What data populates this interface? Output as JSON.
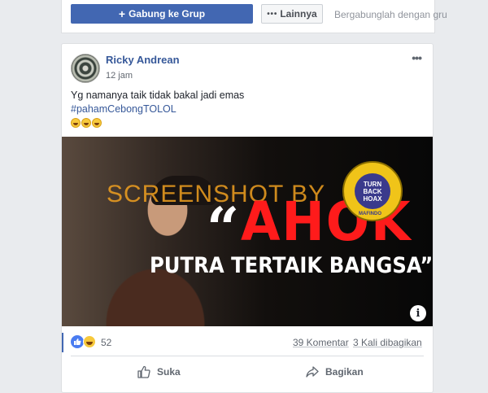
{
  "group_bar": {
    "join_label": "Gabung ke Grup",
    "more_label": "Lainnya",
    "join_hint": "Bergabunglah dengan gru"
  },
  "post": {
    "author": "Ricky Andrean",
    "time": "12 jam",
    "text_line1": "Yg namanya taik tidak bakal jadi emas",
    "hashtag": "#pahamCebongTOLOL",
    "emoji_icons": [
      "laughing-face-icon",
      "laughing-face-icon",
      "laughing-face-icon"
    ],
    "image": {
      "watermark": "SCREENSHOT BY",
      "headline": "AHOK",
      "subline": "PUTRA TERTAIK BANGSA”",
      "badge_text": "TURN BACK HOAX",
      "badge_org": "MAFINDO",
      "badge_ring": "MASYARAKAT ANTI FITNAH INDONESIA"
    }
  },
  "stats": {
    "reaction_count": "52",
    "comments": "39 Komentar",
    "shares": "3 Kali dibagikan"
  },
  "actions": {
    "like_label": "Suka",
    "share_label": "Bagikan"
  },
  "colors": {
    "brand": "#4267b2",
    "link": "#365899",
    "headline_red": "#ff1b1b"
  }
}
